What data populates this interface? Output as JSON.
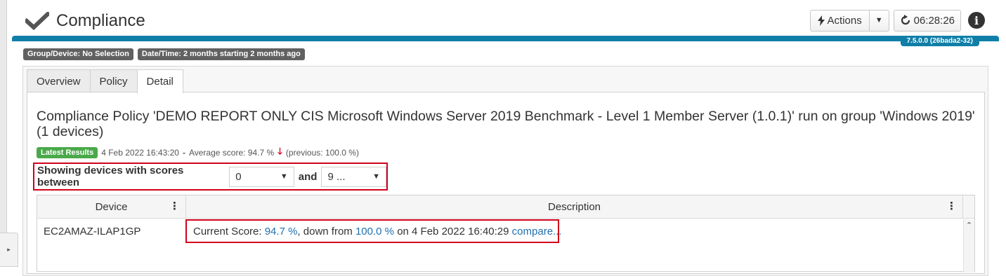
{
  "header": {
    "title": "Compliance",
    "actions_label": "Actions",
    "timer": "06:28:26",
    "version": "7.5.0.0 (26bada2-32)"
  },
  "filters": {
    "group_device": "Group/Device: No Selection",
    "date_time": "Date/Time: 2 months starting 2 months ago"
  },
  "tabs": [
    {
      "label": "Overview",
      "active": false
    },
    {
      "label": "Policy",
      "active": false
    },
    {
      "label": "Detail",
      "active": true
    }
  ],
  "detail": {
    "title": "Compliance Policy 'DEMO REPORT ONLY CIS Microsoft Windows Server 2019 Benchmark - Level 1 Member Server (1.0.1)' run on group 'Windows 2019' (1 devices)",
    "latest_badge": "Latest Results",
    "run_time": "4 Feb 2022 16:43:20",
    "separator": "-",
    "average_score": "Average score: 94.7 %",
    "previous": "(previous: 100.0 %)",
    "score_filter": {
      "label": "Showing devices with scores between",
      "from_value": "0",
      "and_label": "and",
      "to_value": "9 ..."
    }
  },
  "grid": {
    "columns": [
      "Device",
      "Description"
    ],
    "rows": [
      {
        "device": "EC2AMAZ-ILAP1GP",
        "desc_prefix": "Current Score:",
        "current_score": "94.7 %",
        "desc_mid": ", down from",
        "previous_score": "100.0 %",
        "desc_on": "on 4 Feb 2022 16:40:29",
        "compare_link": "compare..."
      }
    ]
  },
  "colors": {
    "accent_blue": "#0f7fa8",
    "highlight_red": "#d0021b",
    "latest_green": "#4aa94a",
    "link_blue": "#1f6fad"
  },
  "icons": [
    "checkmark-icon",
    "lightning-icon",
    "refresh-icon",
    "info-icon",
    "down-arrow-icon",
    "chevron-right-icon",
    "chevron-down-icon",
    "kebab-icon",
    "chevron-up-icon"
  ]
}
